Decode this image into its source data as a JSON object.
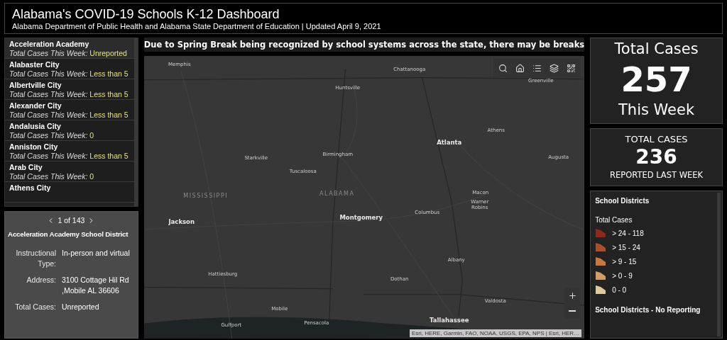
{
  "header": {
    "title": "Alabama's COVID-19 Schools K-12 Dashboard",
    "subtitle": "Alabama Department of Public Health and Alabama State Department of Education | Updated April 9, 2021"
  },
  "district_list": [
    {
      "name": "Acceleration Academy",
      "label": "Total Cases This Week:",
      "value": "Unreported",
      "selected": true
    },
    {
      "name": "Alabaster City",
      "label": "Total Cases This Week:",
      "value": "Less than 5",
      "selected": false
    },
    {
      "name": "Albertville City",
      "label": "Total Cases This Week:",
      "value": "Less than 5",
      "selected": false
    },
    {
      "name": "Alexander City",
      "label": "Total Cases This Week:",
      "value": "Less than 5",
      "selected": false
    },
    {
      "name": "Andalusia City",
      "label": "Total Cases This Week:",
      "value": "0",
      "selected": false
    },
    {
      "name": "Anniston City",
      "label": "Total Cases This Week:",
      "value": "Less than 5",
      "selected": false
    },
    {
      "name": "Arab City",
      "label": "Total Cases This Week:",
      "value": "0",
      "selected": false
    },
    {
      "name": "Athens City",
      "selected": false
    }
  ],
  "details": {
    "pager": "1 of 143",
    "title": "Acceleration Academy School District",
    "fields": [
      {
        "label": "Instructional Type:",
        "value": "In-person and virtual"
      },
      {
        "label": "Address:",
        "value": "3100 Cottage Hil Rd ,Mobile AL 36606"
      },
      {
        "label": "Total Cases:",
        "value": "Unreported"
      }
    ]
  },
  "notice": "Due to Spring Break being recognized by school systems across the state, there may be breaks",
  "map": {
    "labels": [
      {
        "text": "Memphis",
        "kind": "city"
      },
      {
        "text": "Chattanooga",
        "kind": "city"
      },
      {
        "text": "Huntsville",
        "kind": "city"
      },
      {
        "text": "Greenville",
        "kind": "city"
      },
      {
        "text": "Athens",
        "kind": "city"
      },
      {
        "text": "Atlanta",
        "kind": "capital"
      },
      {
        "text": "Augusta",
        "kind": "city"
      },
      {
        "text": "Starkville",
        "kind": "city"
      },
      {
        "text": "Birmingham",
        "kind": "city"
      },
      {
        "text": "Tuscaloosa",
        "kind": "city"
      },
      {
        "text": "ALABAMA",
        "kind": "state"
      },
      {
        "text": "MISSISSIPPI",
        "kind": "state"
      },
      {
        "text": "Macon",
        "kind": "city"
      },
      {
        "text": "Warner Robins",
        "kind": "city"
      },
      {
        "text": "Columbus",
        "kind": "city"
      },
      {
        "text": "Jackson",
        "kind": "capital"
      },
      {
        "text": "Montgomery",
        "kind": "capital"
      },
      {
        "text": "Albany",
        "kind": "city"
      },
      {
        "text": "Hattiesburg",
        "kind": "city"
      },
      {
        "text": "Dothan",
        "kind": "city"
      },
      {
        "text": "Valdosta",
        "kind": "city"
      },
      {
        "text": "Mobile",
        "kind": "city"
      },
      {
        "text": "Gulfport",
        "kind": "city"
      },
      {
        "text": "Pensacola",
        "kind": "city"
      },
      {
        "text": "Tallahassee",
        "kind": "capital"
      }
    ],
    "attribution": "Esri, HERE, Garmin, FAO, NOAA, USGS, EPA, NPS | Esri, HER…"
  },
  "total_this_week": {
    "top": "Total Cases",
    "value": "257",
    "bottom": "This Week"
  },
  "total_last_week": {
    "top": "TOTAL CASES",
    "value": "236",
    "bottom": "REPORTED LAST WEEK"
  },
  "legend": {
    "title": "School Districts",
    "subtitle": "Total Cases",
    "items": [
      {
        "label": "> 24 - 118",
        "color": "#8b2a1c"
      },
      {
        "label": "> 15 - 24",
        "color": "#a8502e"
      },
      {
        "label": "> 9 - 15",
        "color": "#c7773f"
      },
      {
        "label": "> 0 - 9",
        "color": "#cf9c6a"
      },
      {
        "label": "0 - 0",
        "color": "#dcc9a0"
      }
    ],
    "footer": "School Districts - No Reporting"
  }
}
